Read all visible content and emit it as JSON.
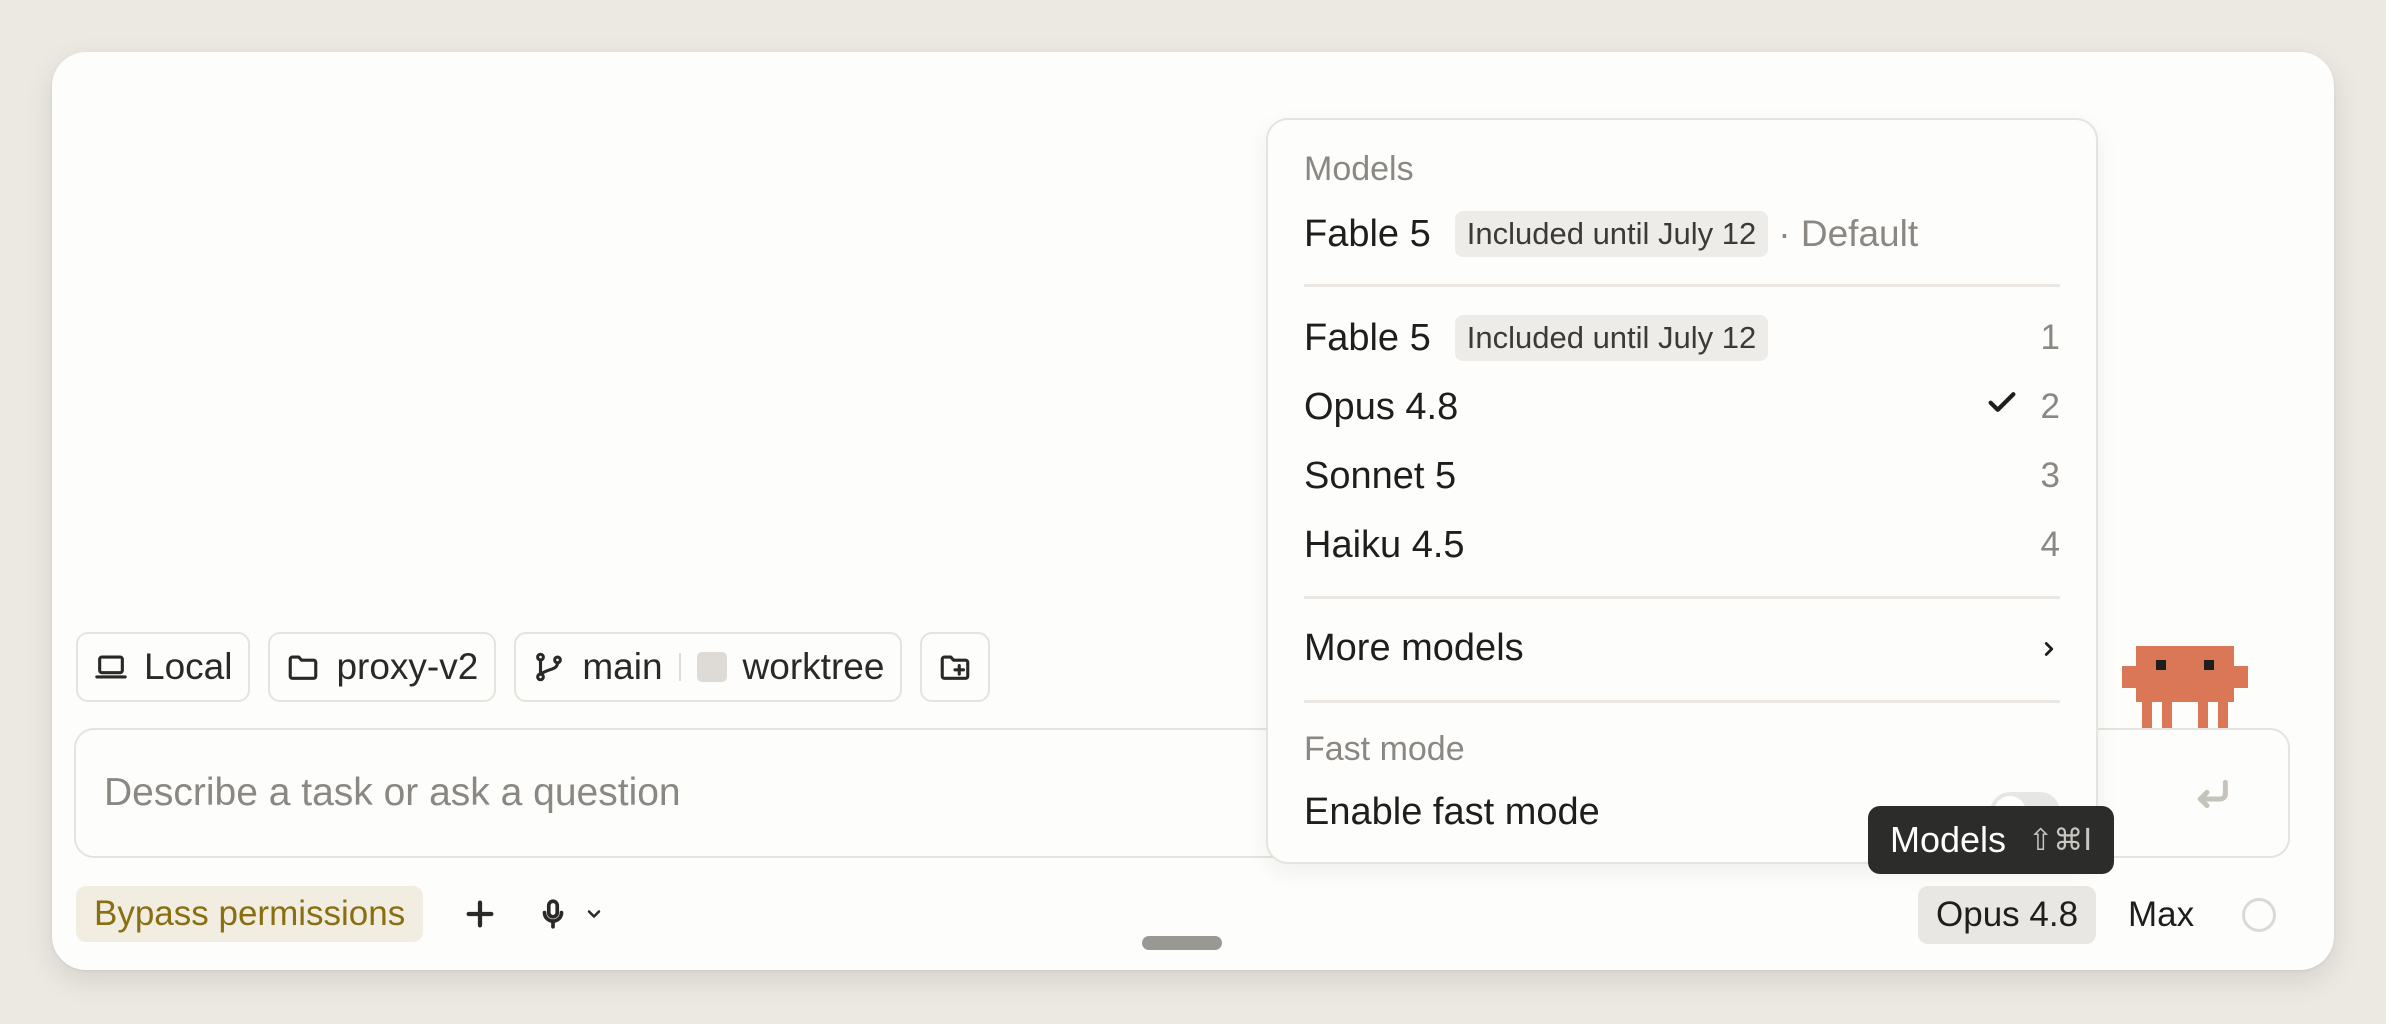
{
  "chips": {
    "environment": "Local",
    "project": "proxy-v2",
    "branch": "main",
    "worktree": "worktree"
  },
  "input": {
    "placeholder": "Describe a task or ask a question"
  },
  "bottom_bar": {
    "permissions_label": "Bypass permissions",
    "model_label": "Opus 4.8",
    "effort_label": "Max"
  },
  "tooltip": {
    "label": "Models",
    "shortcut": "⇧⌘I"
  },
  "menu": {
    "models_title": "Models",
    "default_row": {
      "name": "Fable 5",
      "badge": "Included until July 12",
      "suffix": "· Default"
    },
    "models": [
      {
        "name": "Fable 5",
        "badge": "Included until July 12",
        "shortcut": "1",
        "selected": false
      },
      {
        "name": "Opus 4.8",
        "badge": "",
        "shortcut": "2",
        "selected": true
      },
      {
        "name": "Sonnet 5",
        "badge": "",
        "shortcut": "3",
        "selected": false
      },
      {
        "name": "Haiku 4.5",
        "badge": "",
        "shortcut": "4",
        "selected": false
      }
    ],
    "more_models": "More models",
    "fast_mode_title": "Fast mode",
    "fast_mode_toggle_label": "Enable fast mode",
    "fast_mode_enabled": false
  },
  "colors": {
    "accent_mascot": "#d97757",
    "permissions_text": "#8a6f12",
    "permissions_bg": "#f1ede0"
  }
}
